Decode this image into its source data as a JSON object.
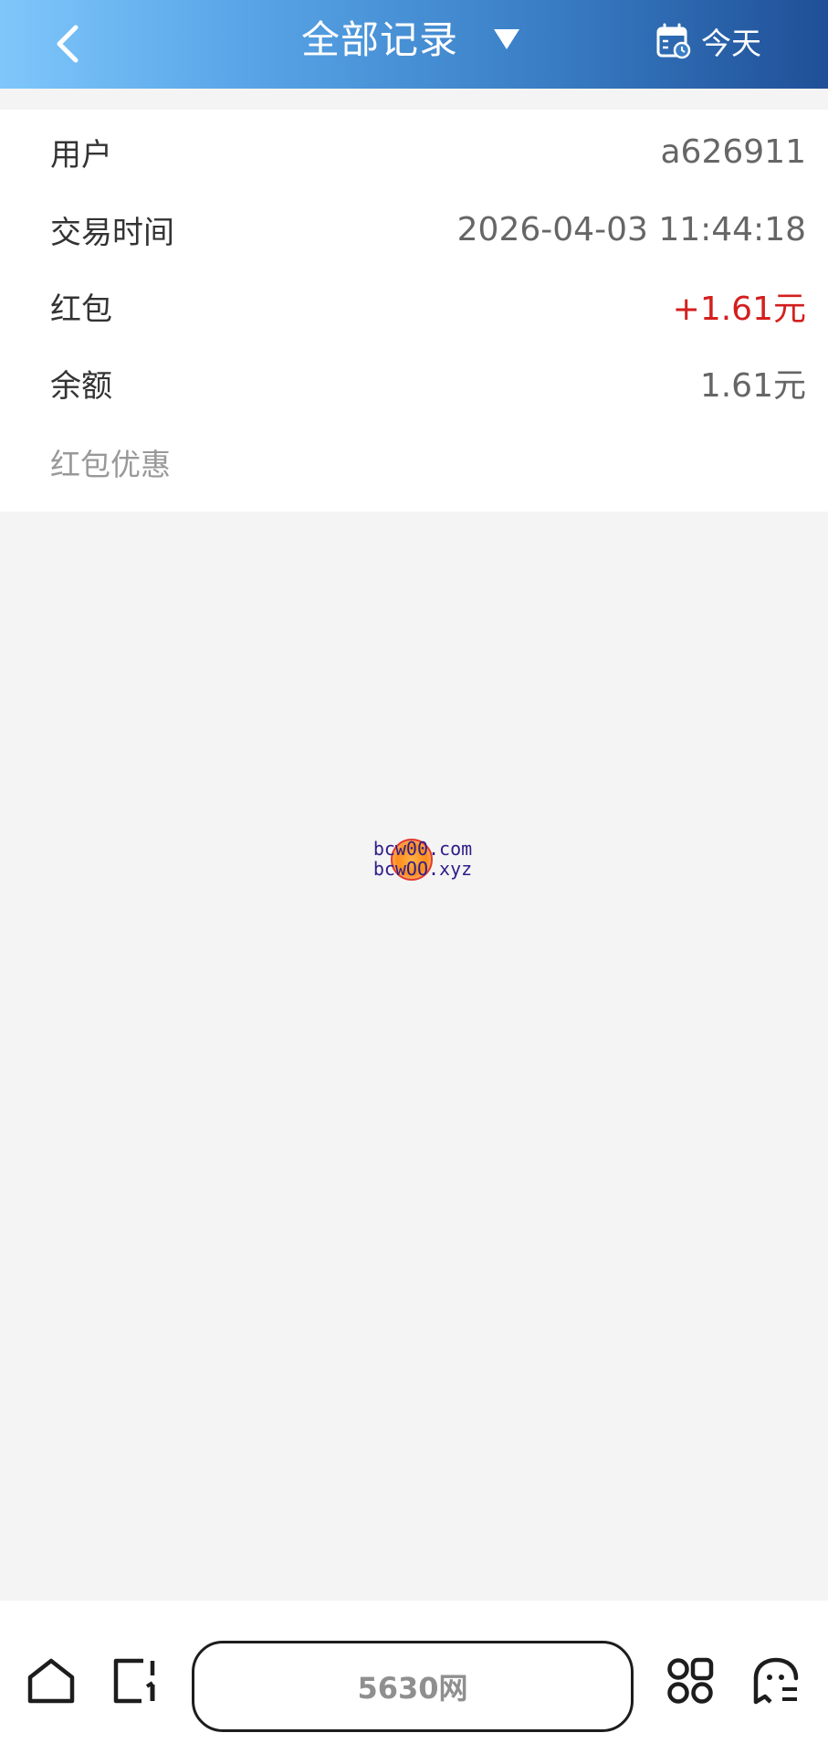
{
  "header": {
    "title": "全部记录",
    "today_label": "今天",
    "gradient_colors": [
      "#7fc7fb",
      "#1f4f97"
    ]
  },
  "details": {
    "rows": [
      {
        "label": "用户",
        "value": "a626911"
      },
      {
        "label": "交易时间",
        "value": "2026-04-03 11:44:18"
      },
      {
        "label": "红包",
        "value": "+1.61元",
        "value_color": "#d41f1f"
      },
      {
        "label": "余额",
        "value": "1.61元"
      }
    ],
    "note": "红包优惠"
  },
  "watermark": {
    "line1": "bcw00.com",
    "line2": "bcwOO.xyz"
  },
  "bottom_bar": {
    "center_label": "5630网",
    "icons": [
      "home-icon",
      "tab-switcher-icon",
      "apps-grid-icon",
      "ghost-icon"
    ]
  }
}
